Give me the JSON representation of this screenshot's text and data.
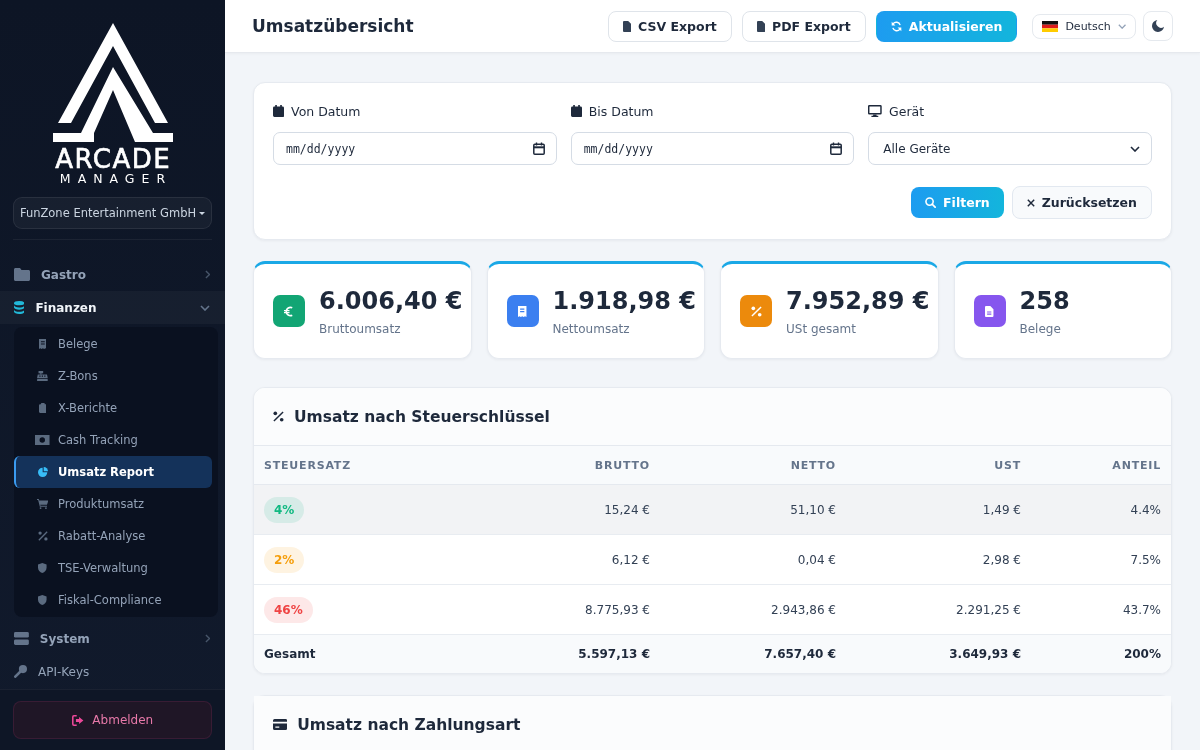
{
  "sidebar": {
    "logo": {
      "title": "ARCADE",
      "subtitle": "MANAGER"
    },
    "company": "FunZone Entertainment GmbH",
    "nav": [
      {
        "kind": "group",
        "label": "Gastro",
        "expanded": false
      },
      {
        "kind": "group",
        "label": "Finanzen",
        "expanded": true,
        "children": [
          {
            "label": "Belege",
            "selected": false
          },
          {
            "label": "Z-Bons",
            "selected": false
          },
          {
            "label": "X-Berichte",
            "selected": false
          },
          {
            "label": "Cash Tracking",
            "selected": false
          },
          {
            "label": "Umsatz Report",
            "selected": true
          },
          {
            "label": "Produktumsatz",
            "selected": false
          },
          {
            "label": "Rabatt-Analyse",
            "selected": false
          },
          {
            "label": "TSE-Verwaltung",
            "selected": false
          },
          {
            "label": "Fiskal-Compliance",
            "selected": false
          }
        ]
      },
      {
        "kind": "group",
        "label": "System",
        "expanded": false
      },
      {
        "kind": "link",
        "label": "API-Keys"
      }
    ],
    "logout": "Abmelden"
  },
  "header": {
    "title": "Umsatzübersicht",
    "buttons": [
      {
        "kind": "outline",
        "label": "CSV Export"
      },
      {
        "kind": "outline",
        "label": "PDF Export"
      },
      {
        "kind": "primary",
        "label": "Aktualisieren"
      }
    ],
    "language": "Deutsch"
  },
  "filter": {
    "fields": [
      {
        "kind": "date",
        "label": "Von Datum",
        "placeholder": "mm/dd/yyyy"
      },
      {
        "kind": "date",
        "label": "Bis Datum",
        "placeholder": "mm/dd/yyyy"
      },
      {
        "kind": "select",
        "label": "Gerät",
        "value": "Alle Geräte"
      }
    ],
    "buttons": [
      {
        "kind": "primary",
        "label": "Filtern"
      },
      {
        "kind": "secondary",
        "label": "Zurücksetzen"
      }
    ]
  },
  "stats": [
    {
      "value": "6.006,40 €",
      "label": "Bruttoumsatz",
      "color": "#12a574"
    },
    {
      "value": "1.918,98 €",
      "label": "Nettoumsatz",
      "color": "#3b7ff0"
    },
    {
      "value": "7.952,89 €",
      "label": "USt gesamt",
      "color": "#ec8a0c"
    },
    {
      "value": "258",
      "label": "Belege",
      "color": "#8656ee"
    }
  ],
  "tax_table": {
    "title": "Umsatz nach Steuerschlüssel",
    "columns": [
      "STEUERSATZ",
      "BRUTTO",
      "NETTO",
      "UST",
      "ANTEIL"
    ],
    "rows": [
      {
        "rate": "4%",
        "color": "#10b981",
        "highlighted": true,
        "values": [
          "15,24 €",
          "51,10 €",
          "1,49 €",
          "4.4%"
        ]
      },
      {
        "rate": "2%",
        "color": "#f59e0b",
        "highlighted": false,
        "values": [
          "6,12 €",
          "0,04 €",
          "2,98 €",
          "7.5%"
        ]
      },
      {
        "rate": "46%",
        "color": "#ef4444",
        "highlighted": false,
        "values": [
          "8.775,93 €",
          "2.943,86 €",
          "2.291,25 €",
          "43.7%"
        ]
      }
    ],
    "total": {
      "label": "Gesamt",
      "values": [
        "5.597,13 €",
        "7.657,40 €",
        "3.649,93 €",
        "200%"
      ]
    }
  },
  "payment_card": {
    "title": "Umsatz nach Zahlungsart"
  }
}
